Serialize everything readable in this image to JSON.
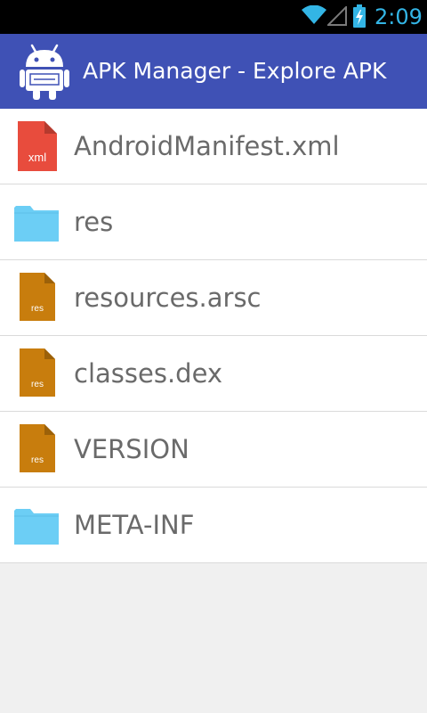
{
  "status_bar": {
    "time": "2:09",
    "icons": [
      "wifi-icon",
      "signal-icon",
      "battery-charging-icon"
    ],
    "time_color": "#33b5e5"
  },
  "action_bar": {
    "app_icon": "android-robot-icon",
    "title": "APK Manager - Explore APK",
    "background_color": "#3f51b5"
  },
  "files": [
    {
      "name": "AndroidManifest.xml",
      "icon": "xml-file-icon",
      "icon_label": "xml"
    },
    {
      "name": "res",
      "icon": "folder-icon"
    },
    {
      "name": "resources.arsc",
      "icon": "res-file-icon",
      "icon_label": "res"
    },
    {
      "name": "classes.dex",
      "icon": "res-file-icon",
      "icon_label": "res"
    },
    {
      "name": "VERSION",
      "icon": "res-file-icon",
      "icon_label": "res"
    },
    {
      "name": "META-INF",
      "icon": "folder-icon"
    }
  ],
  "colors": {
    "xml_icon": "#e84c3d",
    "res_icon": "#c87d0d",
    "folder_icon": "#6ccef5",
    "list_background": "#ffffff",
    "empty_background": "#f0f0f0",
    "text": "#6a6a6a"
  }
}
